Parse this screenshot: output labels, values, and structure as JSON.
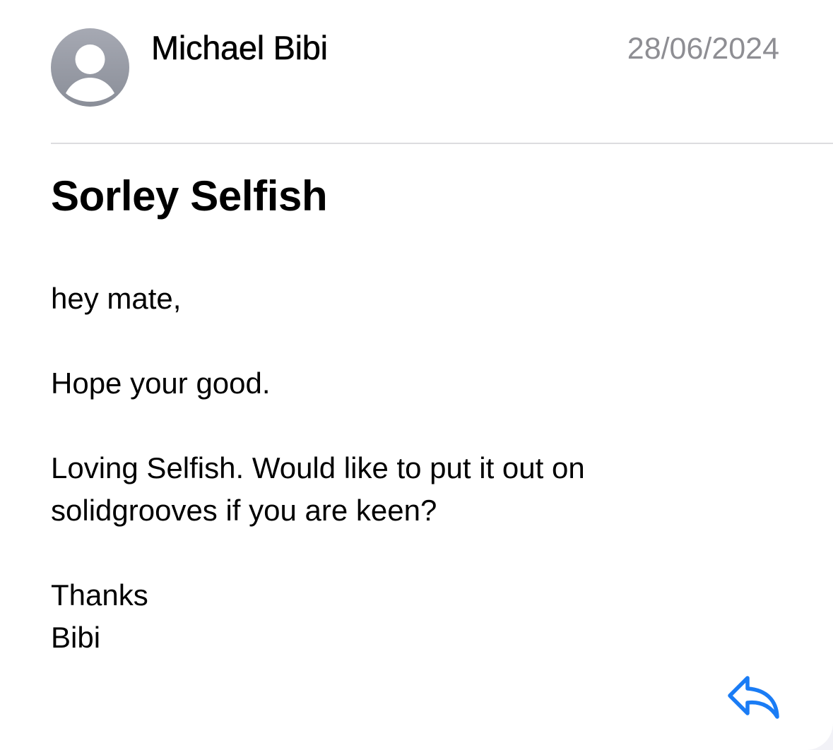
{
  "message": {
    "sender": "Michael Bibi",
    "date": "28/06/2024",
    "subject": "Sorley Selfish",
    "body": {
      "greeting": "hey mate,",
      "line1": "Hope your good.",
      "line2a": "Loving Selfish. Would like to put it out on",
      "line2b": "solidgrooves if you are keen?",
      "signoff": "Thanks",
      "signature": "Bibi"
    }
  },
  "icons": {
    "avatar": "person-placeholder-icon",
    "reply": "reply-arrow-icon"
  },
  "colors": {
    "accent": "#1a7cf5",
    "date_text": "#8e8e93",
    "avatar_bg": "#9a9da7"
  }
}
